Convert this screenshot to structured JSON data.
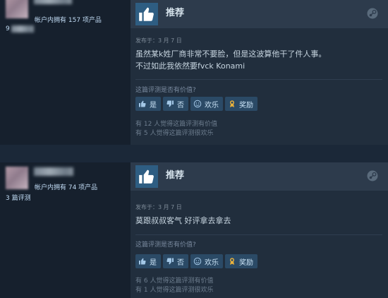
{
  "reviews": [
    {
      "reviewer": {
        "products_owned": "帐户内拥有 157 项产品",
        "review_count": "9"
      },
      "verdict": "推荐",
      "posted": "发布于：3 月 7 日",
      "content": [
        "虽然某k姓厂商非常不要脸，但是这波算他干了件人事。",
        "不过如此我依然要fvck Konami"
      ],
      "helpful_question": "这篇评测是否有价值?",
      "buttons": {
        "yes": "是",
        "no": "否",
        "funny": "欢乐",
        "award": "奖励"
      },
      "stats": [
        "有 12 人觉得这篇评测有价值",
        "有 5 人觉得这篇评测很欢乐"
      ]
    },
    {
      "reviewer": {
        "products_owned": "帐户内拥有 74 项产品",
        "review_count": "3 篇评测"
      },
      "verdict": "推荐",
      "posted": "发布于：3 月 7 日",
      "content": [
        "莫跟叔叔客气 好评拿去拿去"
      ],
      "helpful_question": "这篇评测是否有价值?",
      "buttons": {
        "yes": "是",
        "no": "否",
        "funny": "欢乐",
        "award": "奖励"
      },
      "stats": [
        "有 6 人觉得这篇评测有价值",
        "有 1 人觉得这篇评测很欢乐"
      ]
    }
  ],
  "colors": {
    "page_bg": "#1b2838",
    "review_bg": "#212e3d",
    "header_bg": "#2d3b4c",
    "thumb_bg": "#2e5d82",
    "button_bg": "#2b4a66",
    "award_icon": "#e9b23c"
  },
  "icons": {
    "verdict": "thumbs-up-icon",
    "platform": "steam-icon",
    "yes": "thumbs-up-icon",
    "no": "thumbs-down-icon",
    "funny": "smiley-icon",
    "award": "award-icon"
  }
}
